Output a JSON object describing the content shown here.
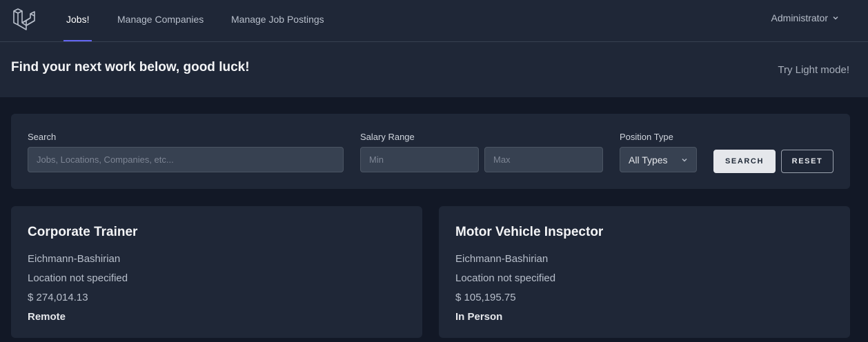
{
  "nav": {
    "links": [
      {
        "label": "Jobs!",
        "active": true
      },
      {
        "label": "Manage Companies",
        "active": false
      },
      {
        "label": "Manage Job Postings",
        "active": false
      }
    ],
    "user": "Administrator"
  },
  "header": {
    "title": "Find your next work below, good luck!",
    "mode_toggle": "Try Light mode!"
  },
  "filters": {
    "search_label": "Search",
    "search_placeholder": "Jobs, Locations, Companies, etc...",
    "salary_label": "Salary Range",
    "min_placeholder": "Min",
    "max_placeholder": "Max",
    "position_label": "Position Type",
    "position_selected": "All Types",
    "search_button": "SEARCH",
    "reset_button": "RESET"
  },
  "jobs": [
    {
      "title": "Corporate Trainer",
      "company": "Eichmann-Bashirian",
      "location": "Location not specified",
      "salary": "$ 274,014.13",
      "type": "Remote"
    },
    {
      "title": "Motor Vehicle Inspector",
      "company": "Eichmann-Bashirian",
      "location": "Location not specified",
      "salary": "$ 105,195.75",
      "type": "In Person"
    }
  ],
  "colors": {
    "accent": "#6366f1",
    "background": "#121826",
    "panel": "#1f2737"
  }
}
